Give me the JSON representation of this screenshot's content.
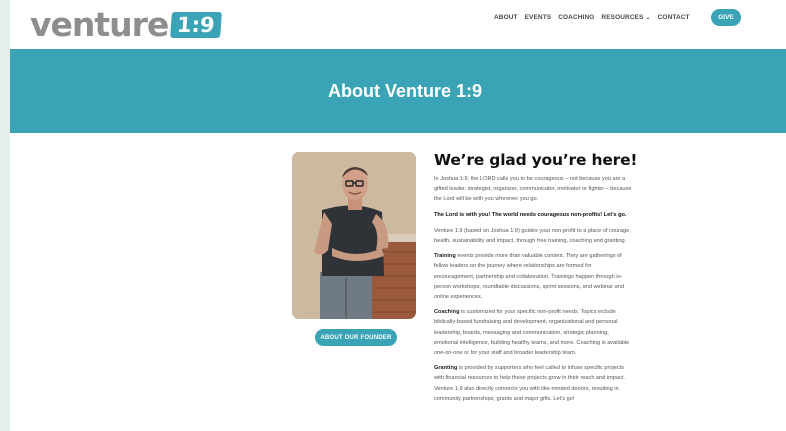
{
  "header": {
    "logo_word": "venture",
    "logo_badge": "1:9",
    "nav": {
      "about": "ABOUT",
      "events": "EVENTS",
      "coaching": "COACHING",
      "resources": "RESOURCES",
      "contact": "CONTACT"
    },
    "give_label": "GIVE"
  },
  "banner": {
    "title": "About Venture 1:9"
  },
  "founder_button": "ABOUT OUR FOUNDER",
  "content": {
    "heading": "We’re glad you’re here!",
    "p1": "In Joshua 1:9, the LORD calls you to be courageous – not because you are a gifted leader, strategist, organizer, communicator, motivator or fighter – because the Lord will be with you wherever you go.",
    "p2": "The Lord is with you! The world needs courageous non-profits! Let’s go.",
    "p3": "Venture 1:9 (based on Joshua 1:9) guides your non-profit to a place of courage, health, sustainability and impact, through free training, coaching and granting.",
    "training_label": "Training",
    "training_text": " events provide more than valuable content. They are gatherings of fellow leaders on the journey where relationships are formed for encouragement, partnership and collaboration. Trainings happen through in-person workshops, roundtable discussions, sprint sessions, and webinar and online experiences.",
    "coaching_label": "Coaching",
    "coaching_text": " is customized for your specific non-profit needs. Topics include biblically-based fundraising and development, organizational and personal leadership, boards, messaging and communication, strategic planning, emotional intelligence, building healthy teams, and more. Coaching is available one-on-one or for your staff and broader leadership team.",
    "granting_label": "Granting",
    "granting_text": " is provided by supporters who feel called to infuse specific projects with financial resources to help these projects grow in their reach and impact. Venture 1:9 also directly connects you with like-minded donors, resulting in community partnerships, grants and major gifts. Let’s go!"
  },
  "colors": {
    "accent": "#3aa3b6",
    "logo_gray": "#8e8e8e"
  }
}
